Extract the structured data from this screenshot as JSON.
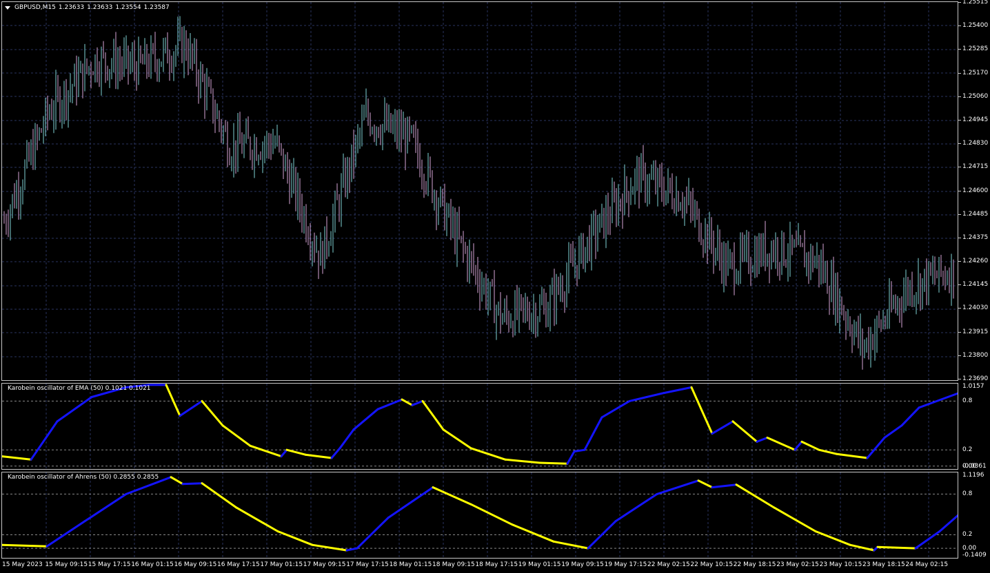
{
  "chart_window": {
    "symbol": "GBPUSD,M15",
    "ohlc": [
      "1.23633",
      "1.23633",
      "1.23554",
      "1.23587"
    ]
  },
  "price_axis": [
    "1.25515",
    "1.25400",
    "1.25285",
    "1.25170",
    "1.25060",
    "1.24945",
    "1.24830",
    "1.24715",
    "1.24600",
    "1.24485",
    "1.24375",
    "1.24260",
    "1.24145",
    "1.24030",
    "1.23915",
    "1.23800",
    "1.23690"
  ],
  "ema_indicator": {
    "label": "Karobein oscillator of EMA (50) 0.1021 0.1021",
    "axis": [
      "1.0157",
      "0.8",
      "0.2",
      "0.00",
      "-0.0361"
    ]
  },
  "ahrens_indicator": {
    "label": "Karobein oscillator of Ahrens (50) 0.2855 0.2855",
    "axis": [
      "1.1196",
      "0.8",
      "0.2",
      "0.00",
      "-0.1409"
    ]
  },
  "time_axis": [
    "15 May 2023",
    "15 May 09:15",
    "15 May 17:15",
    "16 May 01:15",
    "16 May 09:15",
    "16 May 17:15",
    "17 May 01:15",
    "17 May 09:15",
    "17 May 17:15",
    "18 May 01:15",
    "18 May 09:15",
    "18 May 17:15",
    "19 May 01:15",
    "19 May 09:15",
    "19 May 17:15",
    "22 May 02:15",
    "22 May 10:15",
    "22 May 18:15",
    "23 May 02:15",
    "23 May 10:15",
    "23 May 18:15",
    "24 May 02:15"
  ],
  "colors": {
    "background": "#000000",
    "grid": "#2a3560",
    "border": "#c8c8c8",
    "bull_bar": "#7fd3d6",
    "bear_bar": "#d8a6d8",
    "osc_up": "#1414ff",
    "osc_down": "#ffff00",
    "text": "#ffffff"
  },
  "chart_data": [
    {
      "type": "line",
      "title": "GBPUSD,M15",
      "ylim": [
        1.2369,
        1.2557
      ],
      "x": [
        "15 May 2023",
        "15 May 09:15",
        "15 May 17:15",
        "16 May 01:15",
        "16 May 09:15",
        "16 May 17:15",
        "17 May 01:15",
        "17 May 09:15",
        "17 May 17:15",
        "18 May 01:15",
        "18 May 09:15",
        "18 May 17:15",
        "19 May 01:15",
        "19 May 09:15",
        "19 May 17:15",
        "22 May 02:15",
        "22 May 10:15",
        "22 May 18:15",
        "23 May 02:15",
        "23 May 10:15",
        "23 May 18:15",
        "24 May 02:15"
      ],
      "series": [
        {
          "values": [
            1.2448,
            1.2503,
            1.2528,
            1.2525,
            1.2536,
            1.2485,
            1.2487,
            1.243,
            1.25,
            1.2488,
            1.244,
            1.24,
            1.2405,
            1.244,
            1.247,
            1.246,
            1.2425,
            1.2435,
            1.2428,
            1.2385,
            1.2415,
            1.2424
          ]
        }
      ]
    },
    {
      "type": "line",
      "title": "Karobein oscillator of EMA (50) 0.1021 0.1021",
      "ylim": [
        -0.0361,
        1.0157
      ],
      "points": [
        [
          0,
          0.12
        ],
        [
          42,
          0.08
        ],
        [
          80,
          0.55
        ],
        [
          130,
          0.85
        ],
        [
          180,
          0.97
        ],
        [
          213,
          1.0
        ],
        [
          238,
          1.0
        ],
        [
          258,
          0.62
        ],
        [
          290,
          0.8
        ],
        [
          320,
          0.5
        ],
        [
          360,
          0.25
        ],
        [
          405,
          0.12
        ],
        [
          413,
          0.2
        ],
        [
          440,
          0.14
        ],
        [
          478,
          0.1
        ],
        [
          490,
          0.22
        ],
        [
          510,
          0.45
        ],
        [
          545,
          0.7
        ],
        [
          580,
          0.82
        ],
        [
          595,
          0.75
        ],
        [
          610,
          0.8
        ],
        [
          640,
          0.45
        ],
        [
          680,
          0.22
        ],
        [
          730,
          0.08
        ],
        [
          780,
          0.04
        ],
        [
          820,
          0.03
        ],
        [
          830,
          0.18
        ],
        [
          845,
          0.2
        ],
        [
          870,
          0.6
        ],
        [
          910,
          0.8
        ],
        [
          935,
          0.85
        ],
        [
          960,
          0.9
        ],
        [
          1000,
          0.97
        ],
        [
          1030,
          0.4
        ],
        [
          1060,
          0.55
        ],
        [
          1095,
          0.3
        ],
        [
          1110,
          0.35
        ],
        [
          1150,
          0.2
        ],
        [
          1160,
          0.3
        ],
        [
          1185,
          0.2
        ],
        [
          1210,
          0.15
        ],
        [
          1255,
          0.1
        ],
        [
          1280,
          0.35
        ],
        [
          1305,
          0.5
        ],
        [
          1330,
          0.72
        ],
        [
          1388,
          0.9
        ]
      ]
    },
    {
      "type": "line",
      "title": "Karobein oscillator of Ahrens (50) 0.2855 0.2855",
      "ylim": [
        -0.1409,
        1.1196
      ],
      "points": [
        [
          0,
          0.05
        ],
        [
          65,
          0.03
        ],
        [
          120,
          0.4
        ],
        [
          180,
          0.8
        ],
        [
          245,
          1.05
        ],
        [
          262,
          0.95
        ],
        [
          290,
          0.96
        ],
        [
          340,
          0.6
        ],
        [
          400,
          0.25
        ],
        [
          450,
          0.05
        ],
        [
          500,
          -0.03
        ],
        [
          515,
          0.0
        ],
        [
          560,
          0.45
        ],
        [
          625,
          0.9
        ],
        [
          680,
          0.65
        ],
        [
          740,
          0.35
        ],
        [
          800,
          0.1
        ],
        [
          850,
          0.0
        ],
        [
          890,
          0.4
        ],
        [
          950,
          0.8
        ],
        [
          1010,
          1.0
        ],
        [
          1030,
          0.9
        ],
        [
          1065,
          0.94
        ],
        [
          1120,
          0.6
        ],
        [
          1180,
          0.25
        ],
        [
          1230,
          0.05
        ],
        [
          1265,
          -0.03
        ],
        [
          1270,
          0.02
        ],
        [
          1325,
          0.0
        ],
        [
          1360,
          0.25
        ],
        [
          1388,
          0.5
        ]
      ]
    }
  ]
}
